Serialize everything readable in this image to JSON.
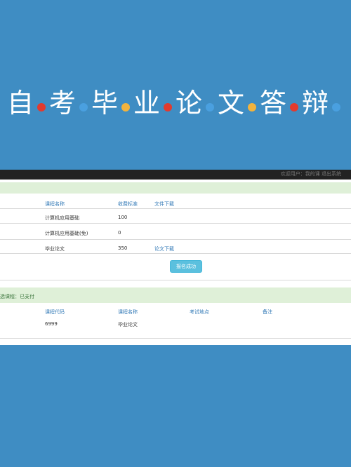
{
  "banner": {
    "chars": [
      "自",
      "考",
      "毕",
      "业",
      "论",
      "文",
      "答",
      "辩"
    ],
    "dot_colors": [
      "#e23a2e",
      "#4aa0e0",
      "#f2b33d",
      "#e23a2e",
      "#4aa0e0",
      "#f2b33d",
      "#e23a2e",
      "#4aa0e0"
    ]
  },
  "topbar": {
    "user_text": "欢迎用户：我的课 退出系统"
  },
  "fee_table": {
    "headers": {
      "course_name": "课程名称",
      "fee_standard": "收费标准",
      "file_download": "文件下载"
    },
    "rows": [
      {
        "course_name": "计算机应用基础",
        "fee": "100",
        "file": ""
      },
      {
        "course_name": "计算机应用基础(免)",
        "fee": "0",
        "file": ""
      },
      {
        "course_name": "毕业论文",
        "fee": "350",
        "file": "论文下载"
      }
    ],
    "status_button": "报名成功"
  },
  "exam_section": {
    "title": "选课程：已支付",
    "headers": {
      "course_code": "课程代码",
      "course_name": "课程名称",
      "exam_location": "考试地点",
      "remarks": "备注"
    },
    "rows": [
      {
        "course_code": "6999",
        "course_name": "毕业论文",
        "exam_location": "",
        "remarks": ""
      }
    ]
  },
  "colors": {
    "background": "#3f8dc3",
    "section_highlight": "#dff0d8",
    "link": "#337ab7",
    "info_button": "#5bc0de"
  }
}
